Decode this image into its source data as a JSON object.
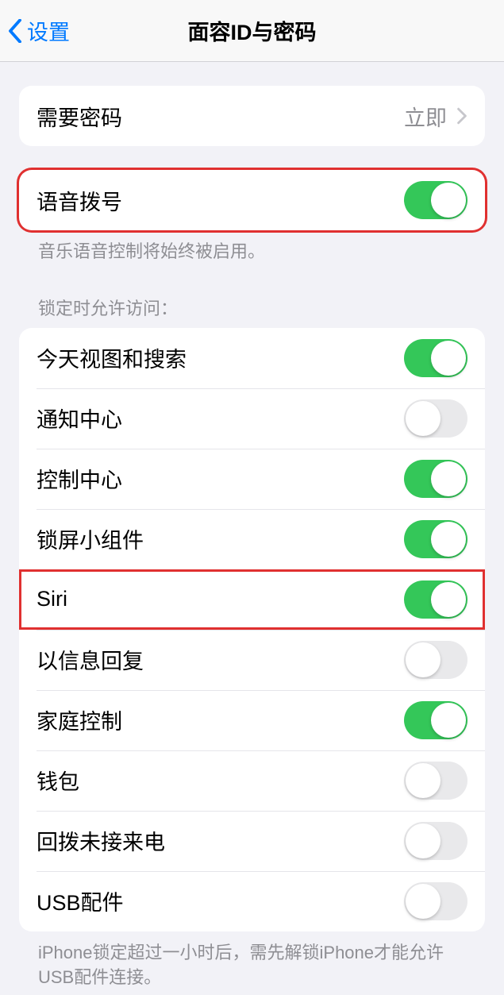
{
  "nav": {
    "back": "设置",
    "title": "面容ID与密码"
  },
  "passcode_group": {
    "label": "需要密码",
    "value": "立即"
  },
  "voice_dial": {
    "label": "语音拨号",
    "on": true,
    "footnote": "音乐语音控制将始终被启用。"
  },
  "lock_access": {
    "header": "锁定时允许访问：",
    "items": [
      {
        "label": "今天视图和搜索",
        "on": true,
        "highlight": false
      },
      {
        "label": "通知中心",
        "on": false,
        "highlight": false
      },
      {
        "label": "控制中心",
        "on": true,
        "highlight": false
      },
      {
        "label": "锁屏小组件",
        "on": true,
        "highlight": false
      },
      {
        "label": "Siri",
        "on": true,
        "highlight": true
      },
      {
        "label": "以信息回复",
        "on": false,
        "highlight": false
      },
      {
        "label": "家庭控制",
        "on": true,
        "highlight": false
      },
      {
        "label": "钱包",
        "on": false,
        "highlight": false
      },
      {
        "label": "回拨未接来电",
        "on": false,
        "highlight": false
      },
      {
        "label": "USB配件",
        "on": false,
        "highlight": false
      }
    ],
    "footnote": "iPhone锁定超过一小时后，需先解锁iPhone才能允许USB配件连接。"
  }
}
